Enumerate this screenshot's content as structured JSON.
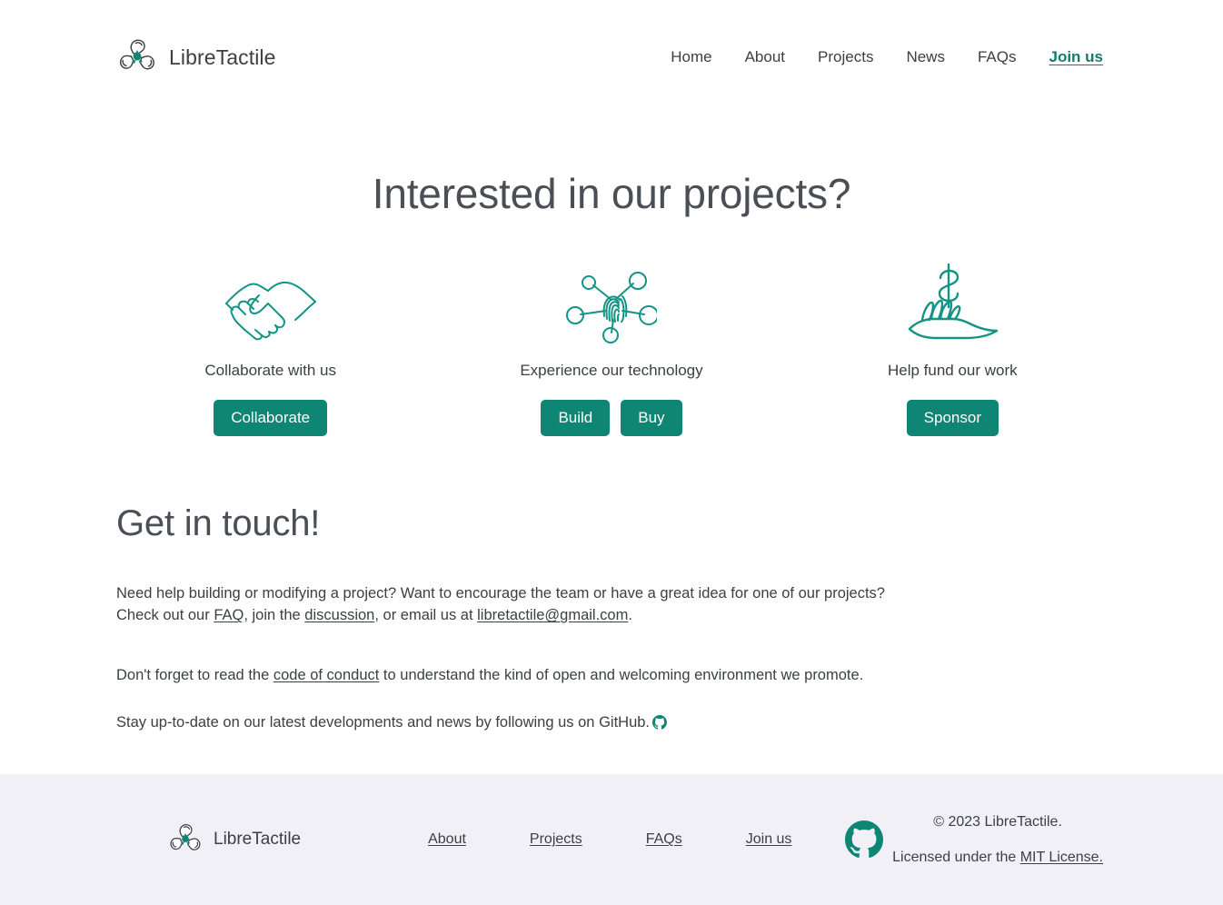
{
  "brand": {
    "name": "LibreTactile",
    "logo_icon": "libretactile-triple-hand-logo"
  },
  "nav": {
    "items": [
      {
        "label": "Home",
        "accent": false
      },
      {
        "label": "About",
        "accent": false
      },
      {
        "label": "Projects",
        "accent": false
      },
      {
        "label": "News",
        "accent": false
      },
      {
        "label": "FAQs",
        "accent": false
      },
      {
        "label": "Join us",
        "accent": true
      }
    ]
  },
  "hero": {
    "title": "Interested in our projects?"
  },
  "cards": [
    {
      "icon": "handshake-icon",
      "label": "Collaborate with us",
      "buttons": [
        "Collaborate"
      ]
    },
    {
      "icon": "fingerprint-network-icon",
      "label": "Experience our technology",
      "buttons": [
        "Build",
        "Buy"
      ]
    },
    {
      "icon": "dollar-hand-icon",
      "label": "Help fund our work",
      "buttons": [
        "Sponsor"
      ]
    }
  ],
  "touch": {
    "title": "Get in touch!",
    "para1": {
      "p1": "Need help building or modifying a project? Want to encourage the team or have a great idea for one of our projects? Check out our ",
      "link1": "FAQ",
      "p2": ", join the ",
      "link2": "discussion",
      "p3": ", or email us at ",
      "link3": "libretactile@gmail.com",
      "p4": "."
    },
    "para2": {
      "p1": "Don't forget to read the ",
      "link1": "code of conduct",
      "p2": " to understand the kind of open and welcoming environment we promote."
    },
    "para3": {
      "p1": "Stay up-to-date on our latest developments and news by following us on GitHub.",
      "icon": "github-icon"
    }
  },
  "footer": {
    "brand_name": "LibreTactile",
    "logo_icon": "libretactile-triple-hand-logo",
    "nav": [
      {
        "label": "About"
      },
      {
        "label": "Projects"
      },
      {
        "label": "FAQs"
      },
      {
        "label": "Join us"
      }
    ],
    "github_icon": "github-icon",
    "copyright": "© 2023 LibreTactile.",
    "license_prefix": "Licensed under the ",
    "license_link": "MIT License."
  },
  "colors": {
    "accent": "#0f8573",
    "accent_link": "#0f7f6c",
    "text": "#3c4043",
    "heading": "#4a4f56",
    "footer_bg": "#f1f0f6",
    "page_bg": "#ffffff"
  }
}
